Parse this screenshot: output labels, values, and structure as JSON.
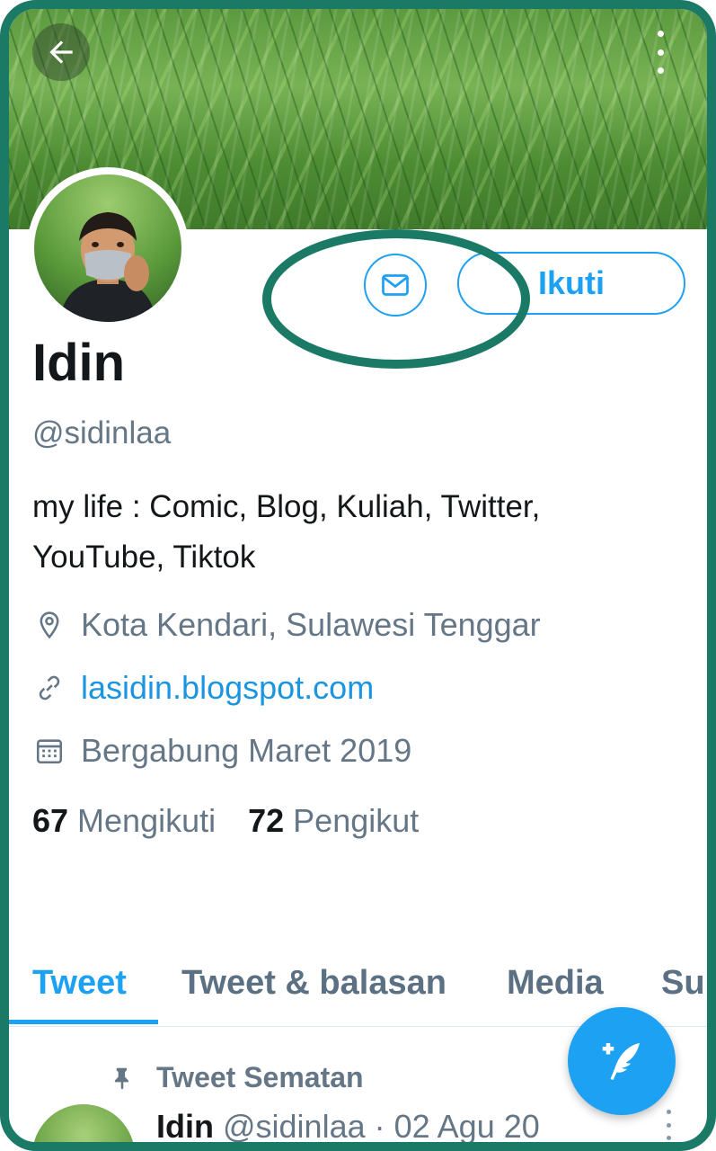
{
  "profile": {
    "name": "Idin",
    "handle": "@sidinlaa",
    "bio_line1": "my life : Comic, Blog, Kuliah, Twitter,",
    "bio_line2": "YouTube, Tiktok",
    "location": "Kota Kendari, Sulawesi Tenggar",
    "website": "lasidin.blogspot.com",
    "joined": "Bergabung Maret 2019"
  },
  "actions": {
    "follow_label": "Ikuti",
    "message_icon": "envelope-icon"
  },
  "stats": {
    "following_count": "67",
    "following_label": "Mengikuti",
    "followers_count": "72",
    "followers_label": "Pengikut"
  },
  "tabs": [
    {
      "label": "Tweet",
      "active": true
    },
    {
      "label": "Tweet & balasan",
      "active": false
    },
    {
      "label": "Media",
      "active": false
    },
    {
      "label": "Su",
      "active": false
    }
  ],
  "pinned_tweet": {
    "label": "Tweet Sematan",
    "author_name": "Idin",
    "author_handle_date": "@sidinlaa · 02 Agu 20"
  },
  "colors": {
    "accent": "#1da1f2",
    "link": "#1b95e0",
    "frame": "#1b7a66",
    "secondary_text": "#657786"
  }
}
